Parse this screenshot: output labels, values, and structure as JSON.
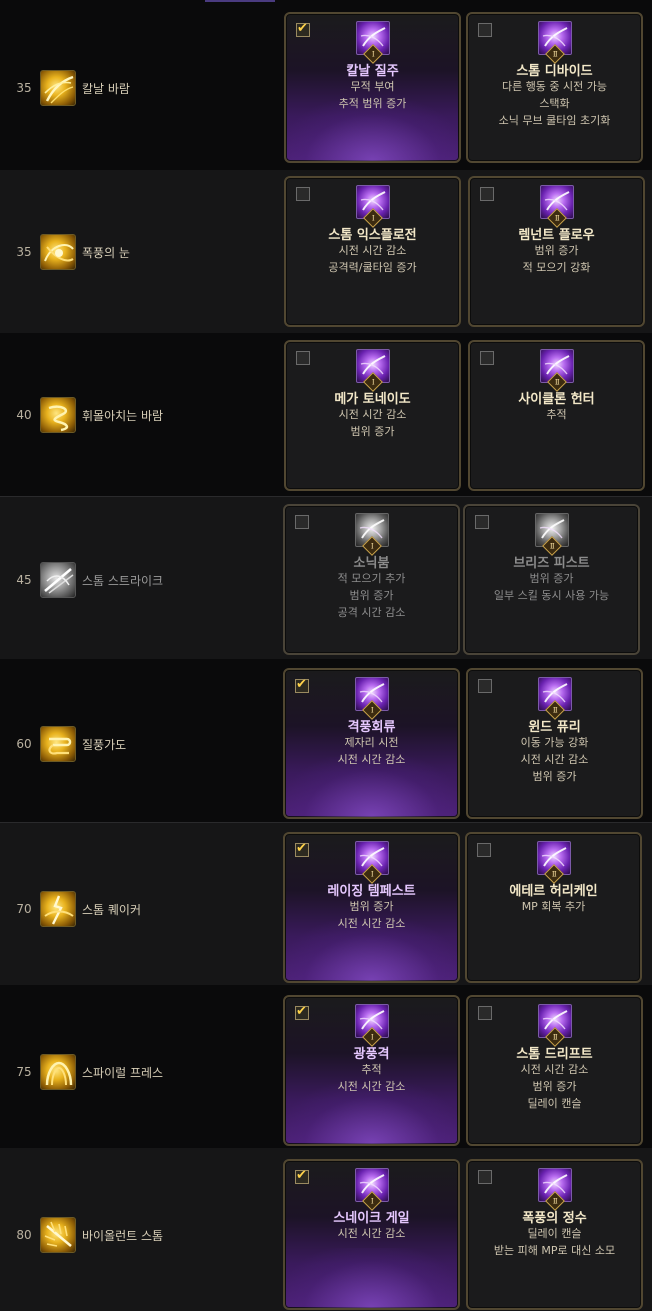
{
  "skills": [
    {
      "level": "35",
      "name": "칼날 바람",
      "icon": "blade-wind-icon",
      "options": [
        {
          "checked": true,
          "rune": "Ⅰ",
          "title": "칼날 질주",
          "lines": [
            "무적 부여",
            "추적 범위 증가"
          ]
        },
        {
          "checked": false,
          "rune": "Ⅱ",
          "title": "스톰 디바이드",
          "lines": [
            "다른 행동 중 시전 가능",
            "스택화",
            "소닉 무브 쿨타임 초기화"
          ]
        }
      ]
    },
    {
      "level": "35",
      "name": "폭풍의 눈",
      "icon": "storm-eye-icon",
      "options": [
        {
          "checked": false,
          "rune": "Ⅰ",
          "title": "스톰 익스플로전",
          "lines": [
            "시전 시간 감소",
            "공격력/쿨타임 증가"
          ]
        },
        {
          "checked": false,
          "rune": "Ⅱ",
          "title": "렘넌트 플로우",
          "lines": [
            "범위 증가",
            "적 모으기 강화"
          ]
        }
      ]
    },
    {
      "level": "40",
      "name": "휘몰아치는 바람",
      "icon": "whirlwind-icon",
      "options": [
        {
          "checked": false,
          "rune": "Ⅰ",
          "title": "메가 토네이도",
          "lines": [
            "시전 시간 감소",
            "범위 증가"
          ]
        },
        {
          "checked": false,
          "rune": "Ⅱ",
          "title": "사이클론 헌터",
          "lines": [
            "추적"
          ]
        }
      ]
    },
    {
      "level": "45",
      "name": "스톰 스트라이크",
      "icon": "storm-strike-icon",
      "options": [
        {
          "checked": false,
          "rune": "Ⅰ",
          "title": "소닉붐",
          "lines": [
            "적 모으기 추가",
            "범위 증가",
            "공격 시간 감소"
          ]
        },
        {
          "checked": false,
          "rune": "Ⅱ",
          "title": "브리즈 피스트",
          "lines": [
            "범위 증가",
            "일부 스킬 동시 사용 가능"
          ]
        }
      ]
    },
    {
      "level": "60",
      "name": "질풍가도",
      "icon": "gale-path-icon",
      "options": [
        {
          "checked": true,
          "rune": "Ⅰ",
          "title": "격풍회류",
          "lines": [
            "제자리 시전",
            "시전 시간 감소"
          ]
        },
        {
          "checked": false,
          "rune": "Ⅱ",
          "title": "윈드 퓨리",
          "lines": [
            "이동 가능 강화",
            "시전 시간 감소",
            "범위 증가"
          ]
        }
      ]
    },
    {
      "level": "70",
      "name": "스톰 퀘이커",
      "icon": "storm-quaker-icon",
      "options": [
        {
          "checked": true,
          "rune": "Ⅰ",
          "title": "레이징 템페스트",
          "lines": [
            "범위 증가",
            "시전 시간 감소"
          ]
        },
        {
          "checked": false,
          "rune": "Ⅱ",
          "title": "에테르 허리케인",
          "lines": [
            "MP 회복 추가"
          ]
        }
      ]
    },
    {
      "level": "75",
      "name": "스파이럴 프레스",
      "icon": "spiral-press-icon",
      "options": [
        {
          "checked": true,
          "rune": "Ⅰ",
          "title": "광풍격",
          "lines": [
            "추적",
            "시전 시간 감소"
          ]
        },
        {
          "checked": false,
          "rune": "Ⅱ",
          "title": "스톰 드리프트",
          "lines": [
            "시전 시간 감소",
            "범위 증가",
            "딜레이 캔슬"
          ]
        }
      ]
    },
    {
      "level": "80",
      "name": "바이올런트 스톰",
      "icon": "violent-storm-icon",
      "options": [
        {
          "checked": true,
          "rune": "Ⅰ",
          "title": "스네이크 게일",
          "lines": [
            "시전 시간 감소"
          ]
        },
        {
          "checked": false,
          "rune": "Ⅱ",
          "title": "폭풍의 정수",
          "lines": [
            "딜레이 캔슬",
            "받는 피해 MP로 대신 소모"
          ]
        }
      ]
    }
  ]
}
